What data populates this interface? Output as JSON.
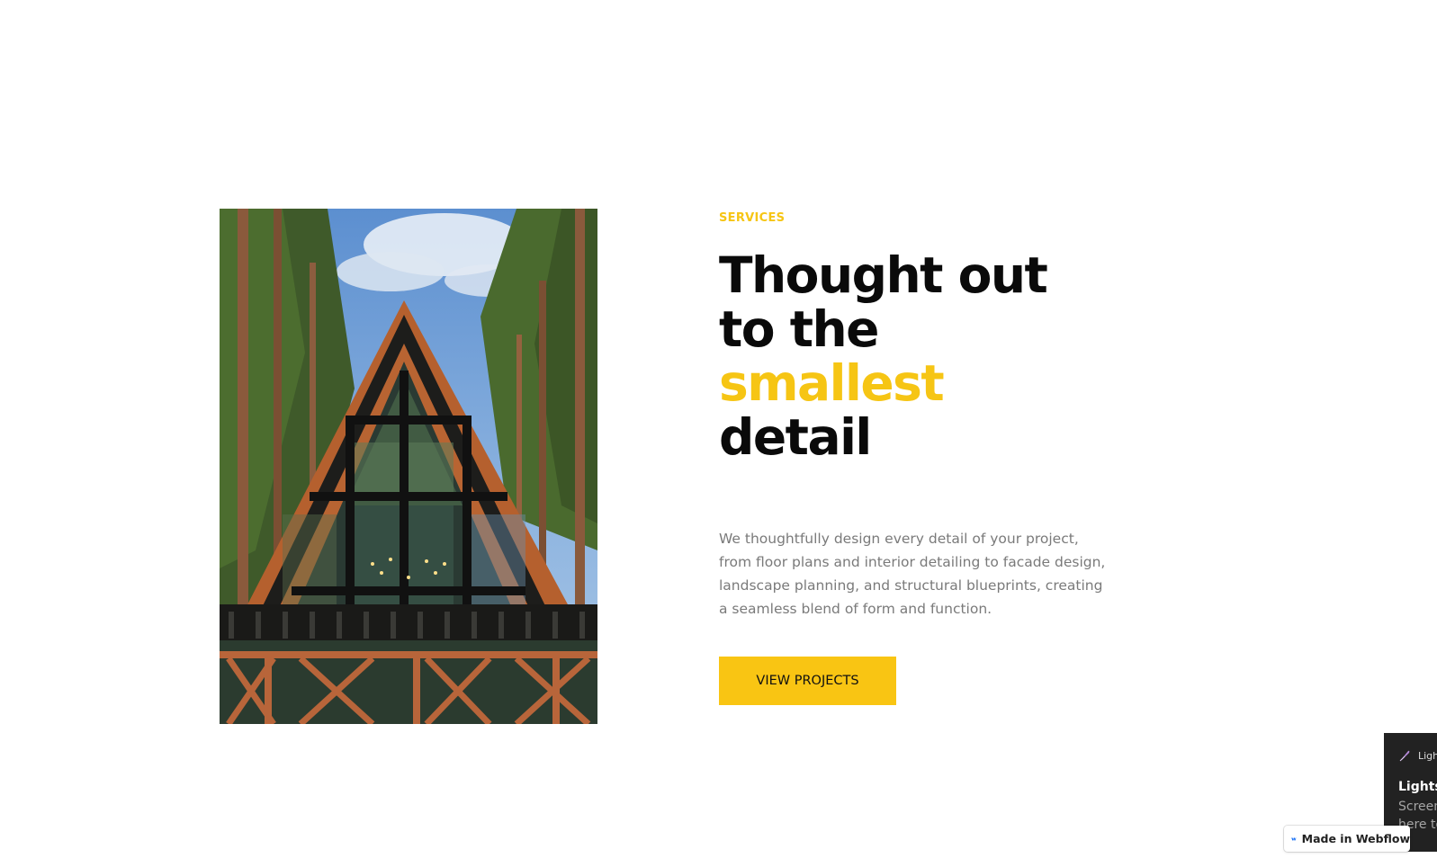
{
  "services_section": {
    "eyebrow": "SERVICES",
    "headline": {
      "line1": "Thought out",
      "line2": "to the",
      "highlight": "smallest",
      "line4": "detail"
    },
    "description": "We thoughtfully design every detail of your project, from floor plans and interior detailing to facade design, landscape planning, and structural blueprints, creating a seamless blend of form and function.",
    "cta_label": "VIEW PROJECTS",
    "image_alt": "A-frame cabin in a pine forest"
  },
  "webflow_badge": {
    "label": "Made in Webflow",
    "icon": "webflow-logo-icon"
  },
  "lightshot_popup": {
    "app_name": "Lightshot",
    "title": "Lightshot",
    "body_line1": "Screenshot saved",
    "body_line2": "here to view",
    "icon": "feather-icon"
  },
  "colors": {
    "accent": "#f6c514",
    "button": "#f9c513",
    "headline": "#0a0a0a",
    "body_text": "#7a7a7a"
  }
}
